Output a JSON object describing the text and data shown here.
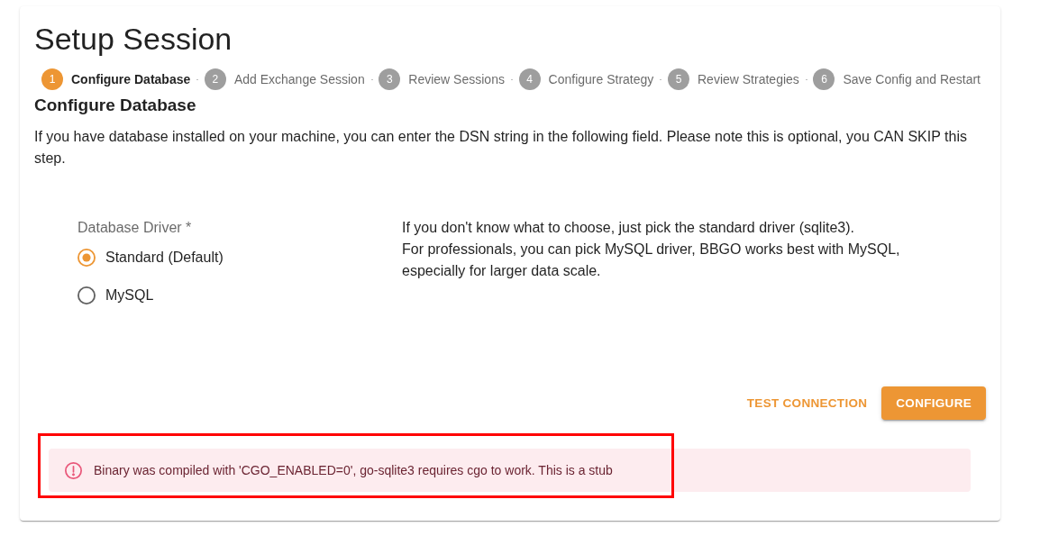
{
  "page": {
    "title": "Setup Session"
  },
  "steps": [
    {
      "number": "1",
      "label": "Configure Database",
      "selected": true
    },
    {
      "number": "2",
      "label": "Add Exchange Session",
      "selected": false
    },
    {
      "number": "3",
      "label": "Review Sessions",
      "selected": false
    },
    {
      "number": "4",
      "label": "Configure Strategy",
      "selected": false
    },
    {
      "number": "5",
      "label": "Review Strategies",
      "selected": false
    },
    {
      "number": "6",
      "label": "Save Config and Restart",
      "selected": false
    }
  ],
  "section": {
    "heading": "Configure Database",
    "description": "If you have database installed on your machine, you can enter the DSN string in the following field. Please note this is optional, you CAN SKIP this step."
  },
  "driver": {
    "label": "Database Driver *",
    "options": [
      {
        "label": "Standard (Default)",
        "selected": true
      },
      {
        "label": "MySQL",
        "selected": false
      }
    ]
  },
  "help": [
    "If you don't know what to choose, just pick the standard driver (sqlite3).",
    "For professionals, you can pick MySQL driver, BBGO works best with MySQL, especially for larger data scale."
  ],
  "actions": [
    {
      "label": "TEST CONNECTION",
      "kind": "text"
    },
    {
      "label": "CONFIGURE",
      "kind": "contained"
    }
  ],
  "alert": {
    "kind": "error",
    "message": "Binary was compiled with 'CGO_ENABLED=0', go-sqlite3 requires cgo to work. This is a stub",
    "highlighted": true
  }
}
